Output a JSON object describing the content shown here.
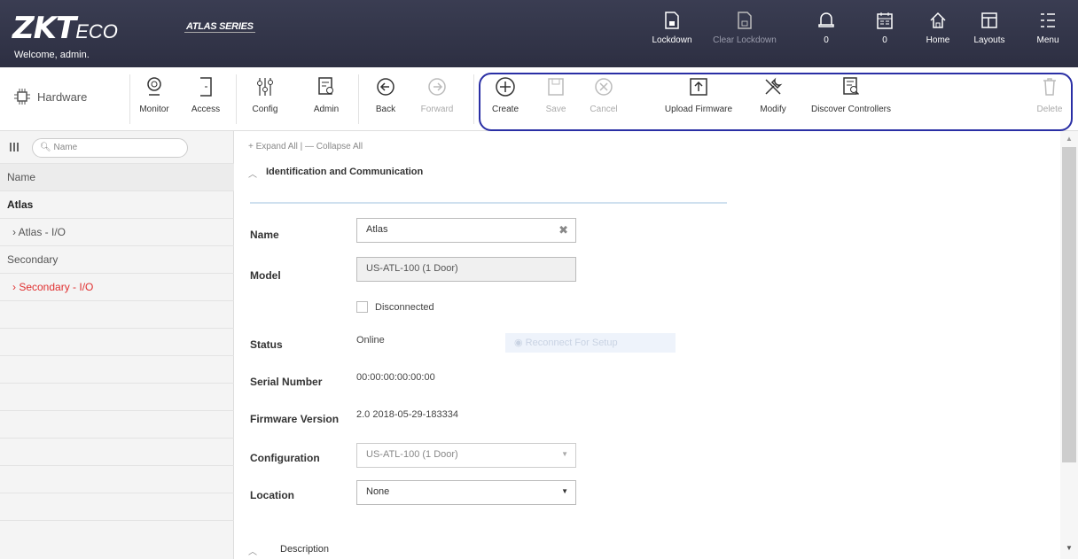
{
  "header": {
    "logo_main": "ZKT",
    "logo_eco": "ECO",
    "welcome": "Welcome, admin.",
    "series": "ATLAS SERIES",
    "buttons": [
      {
        "label": "Lockdown",
        "icon": "lockdown-icon"
      },
      {
        "label": "Clear Lockdown",
        "icon": "clear-lockdown-icon"
      },
      {
        "label": "0",
        "icon": "bell-icon"
      },
      {
        "label": "0",
        "icon": "calendar-icon"
      },
      {
        "label": "Home",
        "icon": "home-icon"
      },
      {
        "label": "Layouts",
        "icon": "layouts-icon"
      },
      {
        "label": "Menu",
        "icon": "menu-icon"
      }
    ]
  },
  "toolbar": {
    "section": "Hardware",
    "tools": [
      {
        "label": "Monitor"
      },
      {
        "label": "Access"
      },
      {
        "label": "Config"
      },
      {
        "label": "Admin"
      },
      {
        "label": "Back"
      },
      {
        "label": "Forward"
      },
      {
        "label": "Create"
      },
      {
        "label": "Save"
      },
      {
        "label": "Cancel"
      },
      {
        "label": "Upload Firmware"
      },
      {
        "label": "Modify"
      },
      {
        "label": "Discover Controllers"
      },
      {
        "label": "Delete"
      }
    ]
  },
  "sidebar": {
    "search_placeholder": "Name",
    "column_header": "Name",
    "items": [
      {
        "label": "Atlas"
      },
      {
        "label": "› Atlas - I/O"
      },
      {
        "label": "Secondary"
      },
      {
        "label": "› Secondary - I/O"
      }
    ]
  },
  "main": {
    "expand_all": "+ Expand All",
    "collapse_all": "— Collapse All",
    "section_title": "Identification and Communication",
    "fields": {
      "name_label": "Name",
      "name_value": "Atlas",
      "model_label": "Model",
      "model_value": "US-ATL-100 (1 Door)",
      "disconnected_label": "Disconnected",
      "status_label": "Status",
      "status_value": "Online",
      "ghost_button": "Reconnect For Setup",
      "serial_label": "Serial Number",
      "serial_value": "00:00:00:00:00:00",
      "firmware_label": "Firmware Version",
      "firmware_value": "2.0 2018-05-29-183334",
      "config_label": "Configuration",
      "config_value": "US-ATL-100 (1 Door)",
      "location_label": "Location",
      "location_value": "None"
    },
    "description_title": "Description"
  }
}
